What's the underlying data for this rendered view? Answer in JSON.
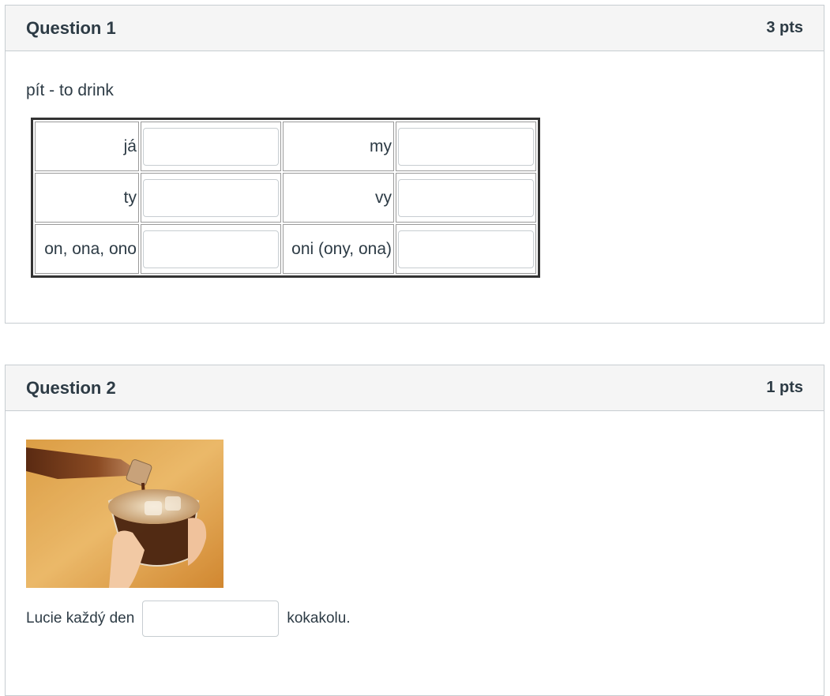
{
  "question1": {
    "title": "Question 1",
    "points": "3 pts",
    "prompt": "pít - to drink",
    "rows": [
      {
        "left_pronoun": "já",
        "right_pronoun": "my"
      },
      {
        "left_pronoun": "ty",
        "right_pronoun": "vy"
      },
      {
        "left_pronoun": "on, ona, ono",
        "right_pronoun": "oni (ony, ona)"
      }
    ]
  },
  "question2": {
    "title": "Question 2",
    "points": "1 pts",
    "sentence_before": "Lucie každý den",
    "sentence_after": "kokakolu."
  }
}
